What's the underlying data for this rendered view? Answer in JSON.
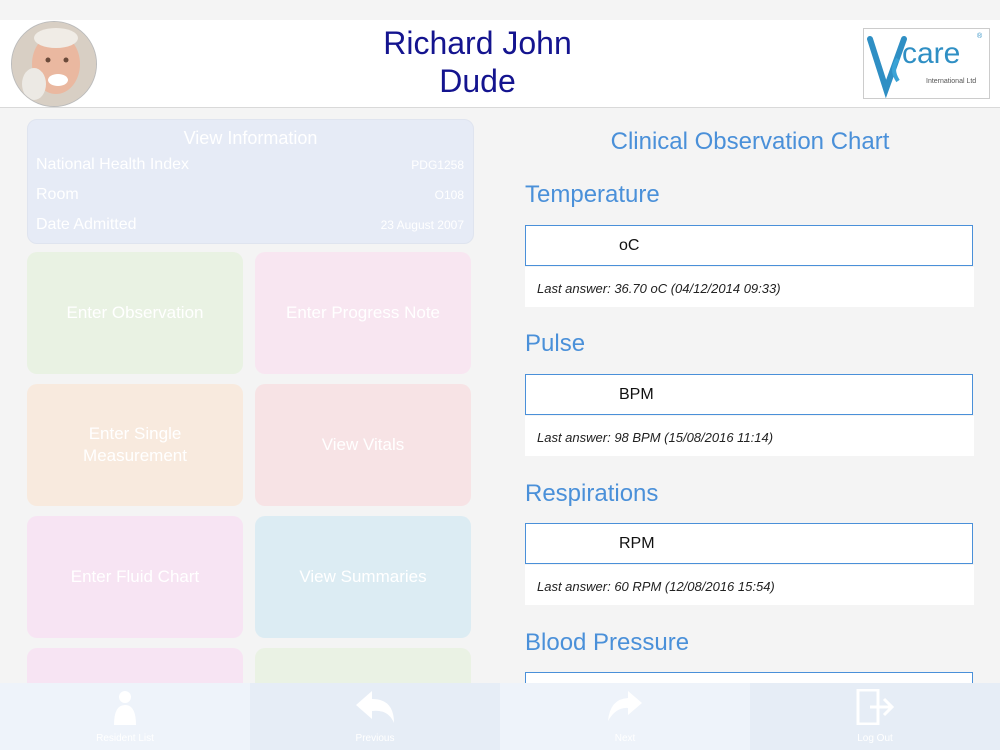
{
  "resident": {
    "first_name": "Richard John",
    "last_name": "Dude"
  },
  "logo": {
    "brand": "care",
    "subtitle": "International Ltd",
    "reg": "®"
  },
  "info": {
    "title": "View Information",
    "rows": [
      {
        "label": "National Health Index",
        "value": "PDG1258"
      },
      {
        "label": "Room",
        "value": "O108"
      },
      {
        "label": "Date Admitted",
        "value": "23 August 2007"
      }
    ]
  },
  "tiles": [
    {
      "label": "Enter Observation",
      "color": "#e9f2e3"
    },
    {
      "label": "Enter Progress Note",
      "color": "#f8e6f1"
    },
    {
      "label": "Enter Single Measurement",
      "color": "#f8eade"
    },
    {
      "label": "View Vitals",
      "color": "#f7e3e5"
    },
    {
      "label": "Enter Fluid Chart",
      "color": "#f7e4f3"
    },
    {
      "label": "View Summaries",
      "color": "#dcecf3"
    }
  ],
  "chart": {
    "title": "Clinical Observation Chart",
    "sections": [
      {
        "label": "Temperature",
        "unit": "oC",
        "last": "Last answer: 36.70 oC (04/12/2014 09:33)"
      },
      {
        "label": "Pulse",
        "unit": "BPM",
        "last": "Last answer: 98 BPM (15/08/2016 11:14)"
      },
      {
        "label": "Respirations",
        "unit": "RPM",
        "last": "Last answer: 60 RPM (12/08/2016 15:54)"
      },
      {
        "label": "Blood Pressure"
      }
    ]
  },
  "bottom": [
    {
      "label": "Resident List",
      "icon": "person-icon"
    },
    {
      "label": "Previous",
      "icon": "reply-arrow-icon"
    },
    {
      "label": "Next",
      "icon": "forward-arrow-icon"
    },
    {
      "label": "Log Out",
      "icon": "logout-icon"
    }
  ]
}
